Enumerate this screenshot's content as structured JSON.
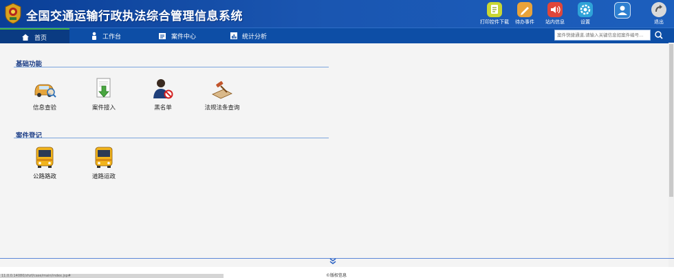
{
  "header": {
    "title": "全国交通运输行政执法综合管理信息系统",
    "tools": [
      {
        "label": "打印控件下载",
        "icon": "printer-download-icon",
        "color": "#c9d733"
      },
      {
        "label": "待办事件",
        "icon": "pencil-task-icon",
        "color": "#e9a33a"
      },
      {
        "label": "站内信息",
        "icon": "speaker-message-icon",
        "color": "#e0463a"
      },
      {
        "label": "设置",
        "icon": "gear-icon",
        "color": "#2fa3d8"
      },
      {
        "label": "",
        "icon": "user-icon",
        "color": "#2e7fd0"
      },
      {
        "label": "退出",
        "icon": "logout-icon",
        "color": "#d9d9d9"
      }
    ]
  },
  "nav": {
    "items": [
      {
        "label": "首页",
        "icon": "home-icon"
      },
      {
        "label": "工作台",
        "icon": "person-icon"
      },
      {
        "label": "案件中心",
        "icon": "document-icon"
      },
      {
        "label": "统计分析",
        "icon": "chart-icon"
      }
    ],
    "search_placeholder": "案件快捷通道,请输入关键信息如案件编号..."
  },
  "sections": [
    {
      "title": "基础功能",
      "tiles": [
        {
          "label": "信息查验",
          "icon": "car-search-icon"
        },
        {
          "label": "案件接入",
          "icon": "download-document-icon"
        },
        {
          "label": "黑名单",
          "icon": "blacklist-person-icon"
        },
        {
          "label": "法规法条查询",
          "icon": "gavel-icon"
        }
      ]
    },
    {
      "title": "案件登记",
      "tiles": [
        {
          "label": "公路路政",
          "icon": "bus-icon"
        },
        {
          "label": "道路运政",
          "icon": "bus-icon"
        }
      ]
    }
  ],
  "footer": {
    "copyright": "©版权信息",
    "status_url": "11.0.0.14080/zhzf/case/main/index.jsp#"
  },
  "colors": {
    "header": "#1a55b0",
    "nav": "#0d4ea6",
    "accent_green": "#3fb545",
    "section_title": "#1e3f87"
  }
}
